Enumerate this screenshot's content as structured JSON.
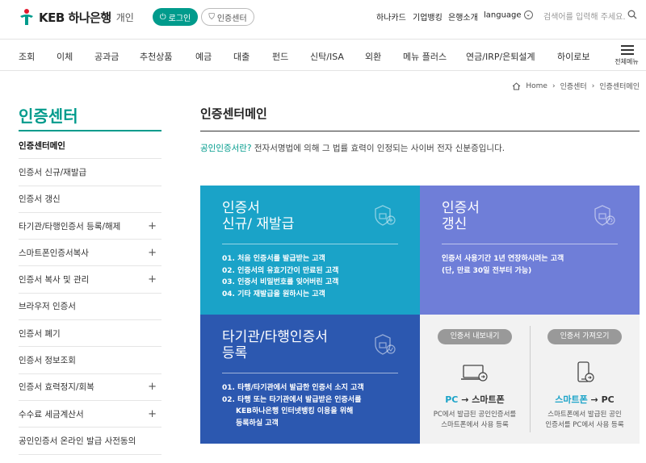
{
  "header": {
    "logo_text": "KEB 하나은행",
    "logo_sub": "개인",
    "login_label": "로그인",
    "cert_center_label": "인증센터",
    "util_links": [
      "하나카드",
      "기업뱅킹",
      "은행소개",
      "language"
    ],
    "search_placeholder": "검색어를 입력해 주세요."
  },
  "nav": {
    "items": [
      "조회",
      "이체",
      "공과금",
      "추천상품",
      "예금",
      "대출",
      "펀드",
      "신탁/ISA",
      "외환",
      "메뉴 플러스",
      "연금/IRP/은퇴설계",
      "하이로보"
    ],
    "all_menu_label": "전체메뉴"
  },
  "breadcrumb": [
    "Home",
    "인증센터",
    "인증센터메인"
  ],
  "sidebar": {
    "title": "인증센터",
    "items": [
      {
        "label": "인증센터메인",
        "plus": ""
      },
      {
        "label": "인증서 신규/재발급",
        "plus": ""
      },
      {
        "label": "인증서 갱신",
        "plus": ""
      },
      {
        "label": "타기관/타행인증서 등록/해제",
        "plus": "+"
      },
      {
        "label": "스마트폰인증서복사",
        "plus": "+"
      },
      {
        "label": "인증서 복사 및 관리",
        "plus": "+"
      },
      {
        "label": "브라우저 인증서",
        "plus": ""
      },
      {
        "label": "인증서 폐기",
        "plus": ""
      },
      {
        "label": "인증서 정보조회",
        "plus": ""
      },
      {
        "label": "인증서 효력정지/회복",
        "plus": "+"
      },
      {
        "label": "수수료 세금계산서",
        "plus": "+"
      },
      {
        "label": "공인인증서 온라인 발급 사전동의",
        "plus": ""
      }
    ]
  },
  "content": {
    "title": "인증센터메인",
    "intro_highlight": "공인인증서란?",
    "intro_text": " 전자서명법에 의해 그 법률 효력이 인정되는 사이버 전자 신분증입니다.",
    "tiles": {
      "new": {
        "title_line1": "인증서",
        "title_line2": "신규/ 재발급",
        "items": [
          "01. 처음 인증서를 발급받는 고객",
          "02. 인증서의 유효기간이 만료된 고객",
          "03. 인증서 비밀번호를 잊어버린 고객",
          "04. 기타 재발급을 원하시는 고객"
        ]
      },
      "renew": {
        "title_line1": "인증서",
        "title_line2": "갱신",
        "items": [
          "인증서 사용기간 1년 연장하시려는 고객",
          "(단, 만료 30일 전부터 가능)"
        ]
      },
      "other": {
        "title_line1": "타기관/타행인증서",
        "title_line2": "등록",
        "items": [
          "01. 타행/타기관에서 발급한 인증서 소지 고객",
          "02. 타행 또는 타기관에서 발급받은 인증서를",
          "KEB하나은행 인터넷뱅킹 이용을 위해",
          "등록하실 고객"
        ]
      },
      "export": {
        "pill": "인증서 내보내기",
        "from": "PC",
        "arrow": " → ",
        "to": "스마트폰",
        "desc1": "PC에서 발급된 공인인증서를",
        "desc2": "스마트폰에서 사용 등록"
      },
      "import": {
        "pill": "인증서 가져오기",
        "from": "스마트폰",
        "arrow": " → ",
        "to": "PC",
        "desc1": "스마트폰에서 발급된 공인",
        "desc2": "인증서를 PC에서 사용 등록"
      }
    }
  },
  "colors": {
    "brand": "#009b8c",
    "tile_new": "#1aa3c8",
    "tile_renew": "#6f7ed8",
    "tile_other": "#2c58b0",
    "tile_copy": "#f2f2f2"
  }
}
